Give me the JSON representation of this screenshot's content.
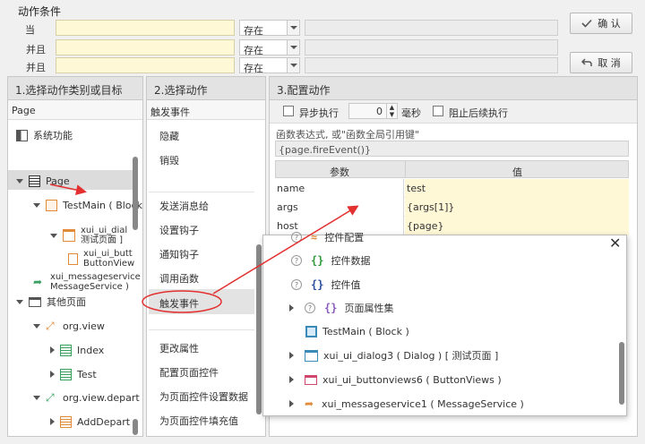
{
  "conditions": {
    "title": "动作条件",
    "rows": [
      {
        "label": "当",
        "op": "存在"
      },
      {
        "label": "并且",
        "op": "存在"
      },
      {
        "label": "并且",
        "op": "存在"
      }
    ]
  },
  "buttons": {
    "confirm": "确 认",
    "cancel": "取 消"
  },
  "panel1": {
    "title": "1.选择动作类别或目标",
    "subtitle": "Page",
    "items": {
      "system": "系统功能",
      "page": "Page",
      "testmain": "TestMain ( Block",
      "dialog_line1": "xui_ui_dial",
      "dialog_line2": "测试页面 ]",
      "button_line1": "xui_ui_butt",
      "button_line2": "ButtonView",
      "msg_line1": "xui_messageservice",
      "msg_line2": "MessageService )",
      "other_pages": "其他页面",
      "orgview": "org.view",
      "index": "Index",
      "test": "Test",
      "orgdepart": "org.view.depart",
      "adddepart": "AddDepart"
    }
  },
  "panel2": {
    "title": "2.选择动作",
    "subtitle": "触发事件",
    "items": [
      "隐藏",
      "销毁",
      "发送消息给",
      "设置钩子",
      "通知钩子",
      "调用函数",
      "触发事件",
      "更改属性",
      "配置页面控件",
      "为页面控件设置数据",
      "为页面控件填充值"
    ]
  },
  "panel3": {
    "title": "3.配置动作",
    "async_label": "异步执行",
    "delay_value": "0",
    "delay_unit": "毫秒",
    "stop_label": "阻止后续执行",
    "expr_label": "函数表达式, 或\"函数全局引用键\"",
    "expr_value": "{page.fireEvent()}",
    "table_headers": {
      "param": "参数",
      "value": "值"
    },
    "rows": [
      {
        "name": "name",
        "value": "test"
      },
      {
        "name": "args",
        "value": "{args[1]}"
      },
      {
        "name": "host",
        "value": "{page}"
      }
    ]
  },
  "popup": {
    "close": "✕",
    "items": {
      "config": "控件配置",
      "data": "控件数据",
      "value": "控件值",
      "pageprops": "页面属性集",
      "testmain": "TestMain ( Block )",
      "dialog": "xui_ui_dialog3 ( Dialog ) [ 测试页面 ]",
      "buttonviews": "xui_ui_buttonviews6 ( ButtonViews )",
      "msgservice": "xui_messageservice1 ( MessageService )"
    }
  },
  "colors": {
    "yellow": "#fff8d7",
    "annotation_red": "#e33030"
  }
}
